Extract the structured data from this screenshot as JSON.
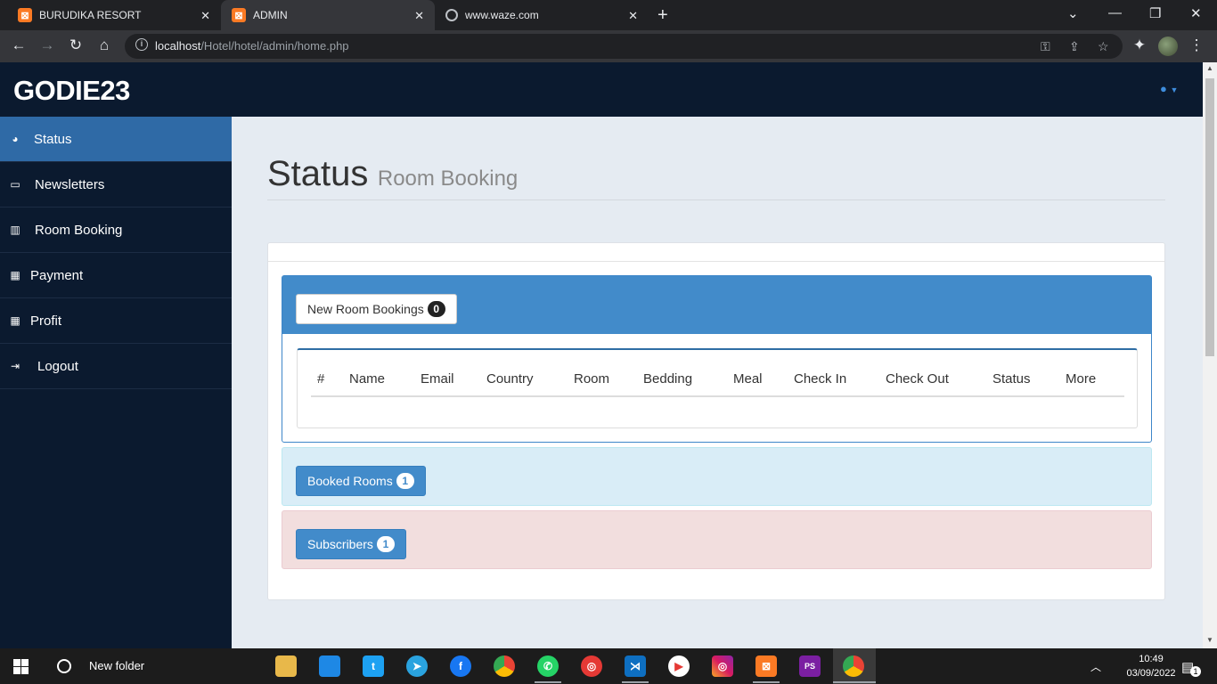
{
  "browser": {
    "tabs": [
      {
        "title": "BURUDIKA RESORT",
        "favicon": "xampp-icon",
        "active": false
      },
      {
        "title": "ADMIN",
        "favicon": "xampp-icon",
        "active": true
      },
      {
        "title": "www.waze.com",
        "favicon": "globe-icon",
        "active": false
      }
    ],
    "url_host": "localhost",
    "url_path": "/Hotel/hotel/admin/home.php"
  },
  "app": {
    "brand": "GODIE23",
    "sidebar": [
      {
        "label": "Status",
        "icon": "dashboard-icon",
        "active": true
      },
      {
        "label": "Newsletters",
        "icon": "desktop-icon",
        "active": false
      },
      {
        "label": "Room Booking",
        "icon": "bar-chart-icon",
        "active": false
      },
      {
        "label": "Payment",
        "icon": "qrcode-icon",
        "active": false
      },
      {
        "label": "Profit",
        "icon": "qrcode-icon",
        "active": false
      },
      {
        "label": "Logout",
        "icon": "sign-out-icon",
        "active": false
      }
    ],
    "page_title": "Status",
    "page_subtitle": "Room Booking",
    "new_bookings": {
      "label": "New Room Bookings",
      "count": "0"
    },
    "table_headers": [
      "#",
      "Name",
      "Email",
      "Country",
      "Room",
      "Bedding",
      "Meal",
      "Check In",
      "Check Out",
      "Status",
      "More"
    ],
    "booked_rooms": {
      "label": "Booked Rooms",
      "count": "1"
    },
    "subscribers": {
      "label": "Subscribers",
      "count": "1"
    }
  },
  "taskbar": {
    "search_text": "New folder",
    "time": "10:49",
    "date": "03/09/2022",
    "notifications": "1"
  },
  "colors": {
    "navy": "#0b1a2f",
    "primary": "#428bca",
    "active_sidebar": "#2f6aa6",
    "info_bg": "#d9edf7",
    "danger_bg": "#f2dede"
  }
}
